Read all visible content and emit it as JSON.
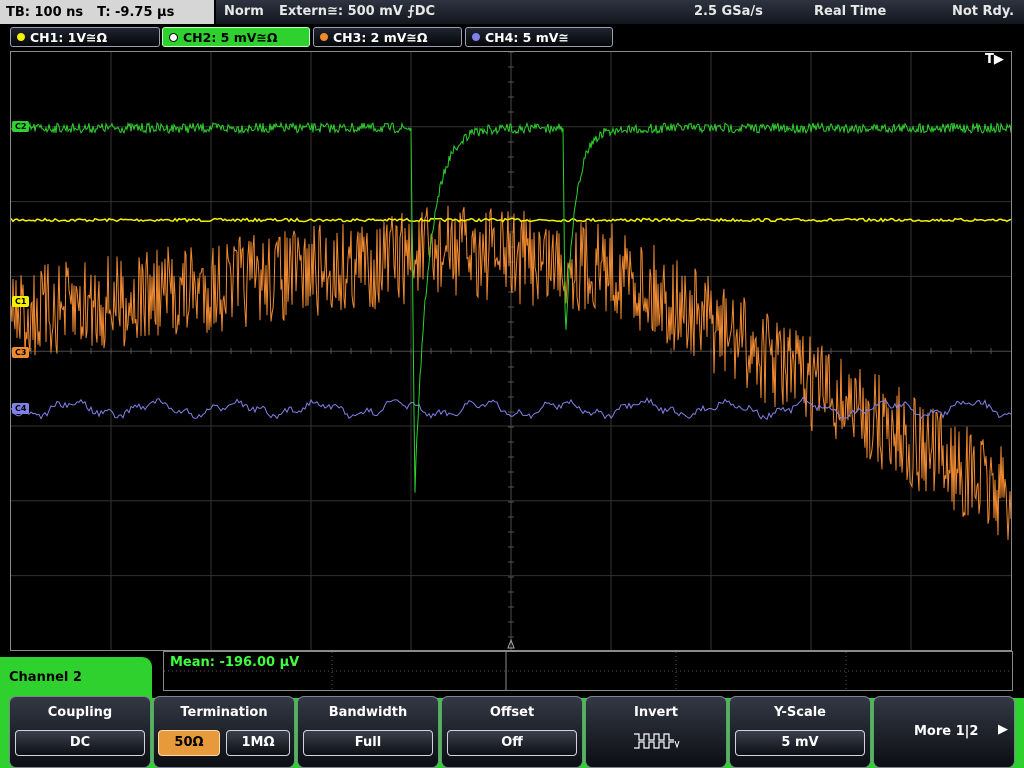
{
  "status": {
    "timebase": "TB: 100 ns",
    "trigger_time": "T: -9.75 µs",
    "mode": "Norm",
    "trigger": "Extern≅: 500 mV ⨍DC",
    "sample_rate": "2.5 GSa/s",
    "acq_mode": "Real Time",
    "ready": "Not Rdy."
  },
  "channels": [
    {
      "label": "CH1: 1V≅Ω",
      "color": "#f5f200"
    },
    {
      "label": "CH2: 5 mV≅Ω",
      "color": "#2ed12e"
    },
    {
      "label": "CH3: 2 mV≅Ω",
      "color": "#f08a30"
    },
    {
      "label": "CH4: 5 mV≅",
      "color": "#8080e8"
    }
  ],
  "markers": {
    "c2": "C2",
    "c1": "C1",
    "c3": "C3",
    "c4": "C4",
    "trigger": "T▶"
  },
  "measurement": {
    "text": "Mean: -196.00 µV"
  },
  "menu": {
    "title": "Channel 2",
    "coupling": {
      "label": "Coupling",
      "value": "DC"
    },
    "termination": {
      "label": "Termination",
      "option1": "50Ω",
      "option2": "1MΩ",
      "selected": "50Ω"
    },
    "bandwidth": {
      "label": "Bandwidth",
      "value": "Full"
    },
    "offset": {
      "label": "Offset",
      "value": "Off"
    },
    "invert": {
      "label": "Invert"
    },
    "yscale": {
      "label": "Y-Scale",
      "value": "5 mV"
    },
    "more": {
      "label": "More 1|2"
    }
  }
}
